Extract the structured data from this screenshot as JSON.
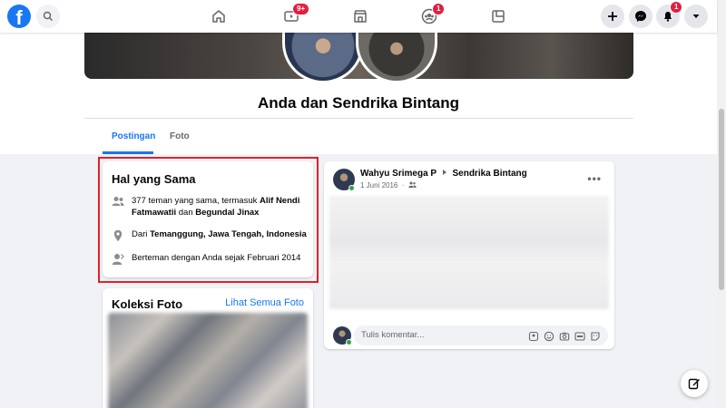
{
  "nav": {
    "logo": "f",
    "icons": [
      "home-icon",
      "watch-icon",
      "marketplace-icon",
      "groups-icon",
      "gaming-icon"
    ],
    "watch_badge": "9+",
    "groups_badge": "1",
    "notifications_badge": "1",
    "right_buttons": [
      "create-icon",
      "messenger-icon",
      "notifications-icon",
      "account-icon"
    ]
  },
  "header": {
    "title": "Anda dan Sendrika Bintang"
  },
  "tabs": {
    "posts": "Postingan",
    "photos": "Foto"
  },
  "intro": {
    "title": "Hal yang Sama",
    "mutual_prefix": "377 teman yang sama, termasuk ",
    "mutual_name1": "Alif Nendi Fatmawatii",
    "mutual_and": " dan ",
    "mutual_name2": "Begundal Jinax",
    "location_prefix": "Dari ",
    "location": "Temanggung, Jawa Tengah, Indonesia",
    "friends_since": "Berteman dengan Anda sejak Februari 2014"
  },
  "photos": {
    "title": "Koleksi Foto",
    "see_all": "Lihat Semua Foto"
  },
  "post": {
    "author": "Wahyu Srimega P",
    "target": "Sendrika Bintang",
    "date": "1 Juni 2016",
    "comment_placeholder": "Tulis komentar..."
  },
  "colors": {
    "brand": "#1877f2",
    "badge": "#e41e3f",
    "highlight": "#e0202b",
    "online": "#31a24c"
  }
}
